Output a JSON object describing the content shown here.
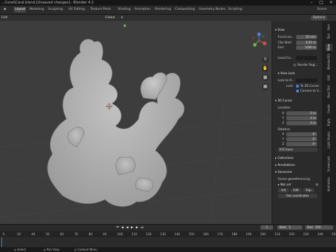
{
  "window": {
    "title": "...Coral\\Coral.blend [Unsaved changes] - Blender 4.1"
  },
  "menu": {
    "workspaces": [
      "Layout",
      "Modeling",
      "Sculpting",
      "UV Editing",
      "Texture Paint",
      "Shading",
      "Animation",
      "Rendering",
      "Compositing",
      "Geometry Nodes",
      "Scripting"
    ],
    "active_workspace": "Layout",
    "scene": "Scene"
  },
  "header": {
    "mode": "Object Mode",
    "view": "View",
    "select": "Select",
    "add": "Add",
    "object": "Object",
    "orientation": "Global",
    "options": "Options",
    "edit": "Edit"
  },
  "npanel": {
    "view_header": "View",
    "focal_label": "Focal Len...",
    "focal_value": "50 mm",
    "clip_start_label": "Clip Start",
    "clip_start_value": "0.01 m",
    "end_label": "End",
    "end_value": "1000 m",
    "local_camera_label": "Local Ca...",
    "render_region_label": "Render Regi...",
    "view_lock_header": "View Lock",
    "lock_object_label": "Lock to O...",
    "lock_label": "Lock",
    "to_3d_cursor_label": "To 3D Cursor",
    "camera_to_view_label": "Camera to V...",
    "cursor_header": "3D Cursor",
    "location_label": "Location",
    "x_label": "X",
    "y_label": "Y",
    "z_label": "Z",
    "loc_x": "0 m",
    "loc_y": "0 m",
    "loc_z": "0 m",
    "rotation_label": "Rotation",
    "rot_x": "0°",
    "rot_y": "0°",
    "rot_z": "0°",
    "rotation_mode": "XYZ Euler",
    "collections_header": "Collections",
    "annotations_header": "Annotations",
    "geoscene_header": "Geoscene",
    "georef_label": "Scene georeferencing",
    "not_set_label": "Not set",
    "geo_btn_1": "Init",
    "geo_btn_2": "Edit",
    "geo_btn_3": "Exp",
    "geo_coords_label": "Geo coordinates"
  },
  "vtabs": [
    "Item",
    "Tool",
    "View",
    "BlenderGIS",
    "Edit",
    "Bool Tool",
    "Create",
    "Rigify",
    "Light Studio",
    "Screencast",
    "Animation"
  ],
  "vtab_active": "View",
  "timeline": {
    "playback": "Playback",
    "keying": "Keying",
    "view": "View",
    "marker": "Marker",
    "current": "1",
    "start_label": "Start",
    "start": "1",
    "end_label": "End",
    "end": "250",
    "ruler": [
      "0",
      "20",
      "40",
      "50",
      "60",
      "70",
      "80",
      "90",
      "100",
      "110",
      "120",
      "130",
      "140",
      "150",
      "160",
      "170",
      "180",
      "190",
      "200",
      "210",
      "220",
      "230",
      "240",
      "250"
    ]
  },
  "status": {
    "hint_1": "Select",
    "hint_2": "Pan View",
    "hint_3": "Context Menu"
  }
}
